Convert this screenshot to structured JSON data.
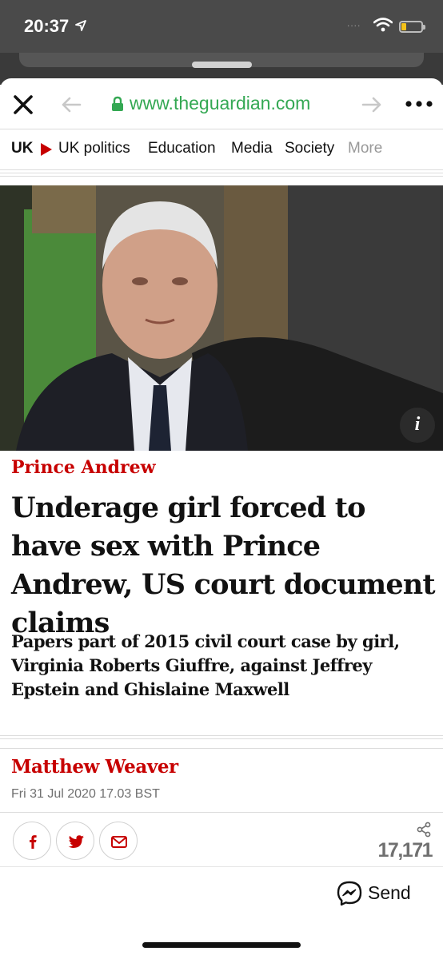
{
  "status_bar": {
    "time": "20:37",
    "signal_dots": "....",
    "battery_color": "#f4c21a"
  },
  "browser": {
    "url": "www.theguardian.com",
    "url_color": "#34a853"
  },
  "nav": {
    "section": "UK",
    "items": [
      "UK politics",
      "Education",
      "Media",
      "Society"
    ],
    "more": "More",
    "accent": "#c70000"
  },
  "article": {
    "info_label": "i",
    "kicker": "Prince Andrew",
    "headline": "Underage girl forced to have sex with Prince Andrew, US court document claims",
    "standfirst": "Papers part of 2015 civil court case by girl, Virginia Roberts Giuffre, against Jeffrey Epstein and Ghislaine Maxwell",
    "byline": "Matthew Weaver",
    "date": "Fri 31 Jul 2020 17.03 BST",
    "share_count": "17,171"
  },
  "bottom_bar": {
    "send_label": "Send"
  }
}
